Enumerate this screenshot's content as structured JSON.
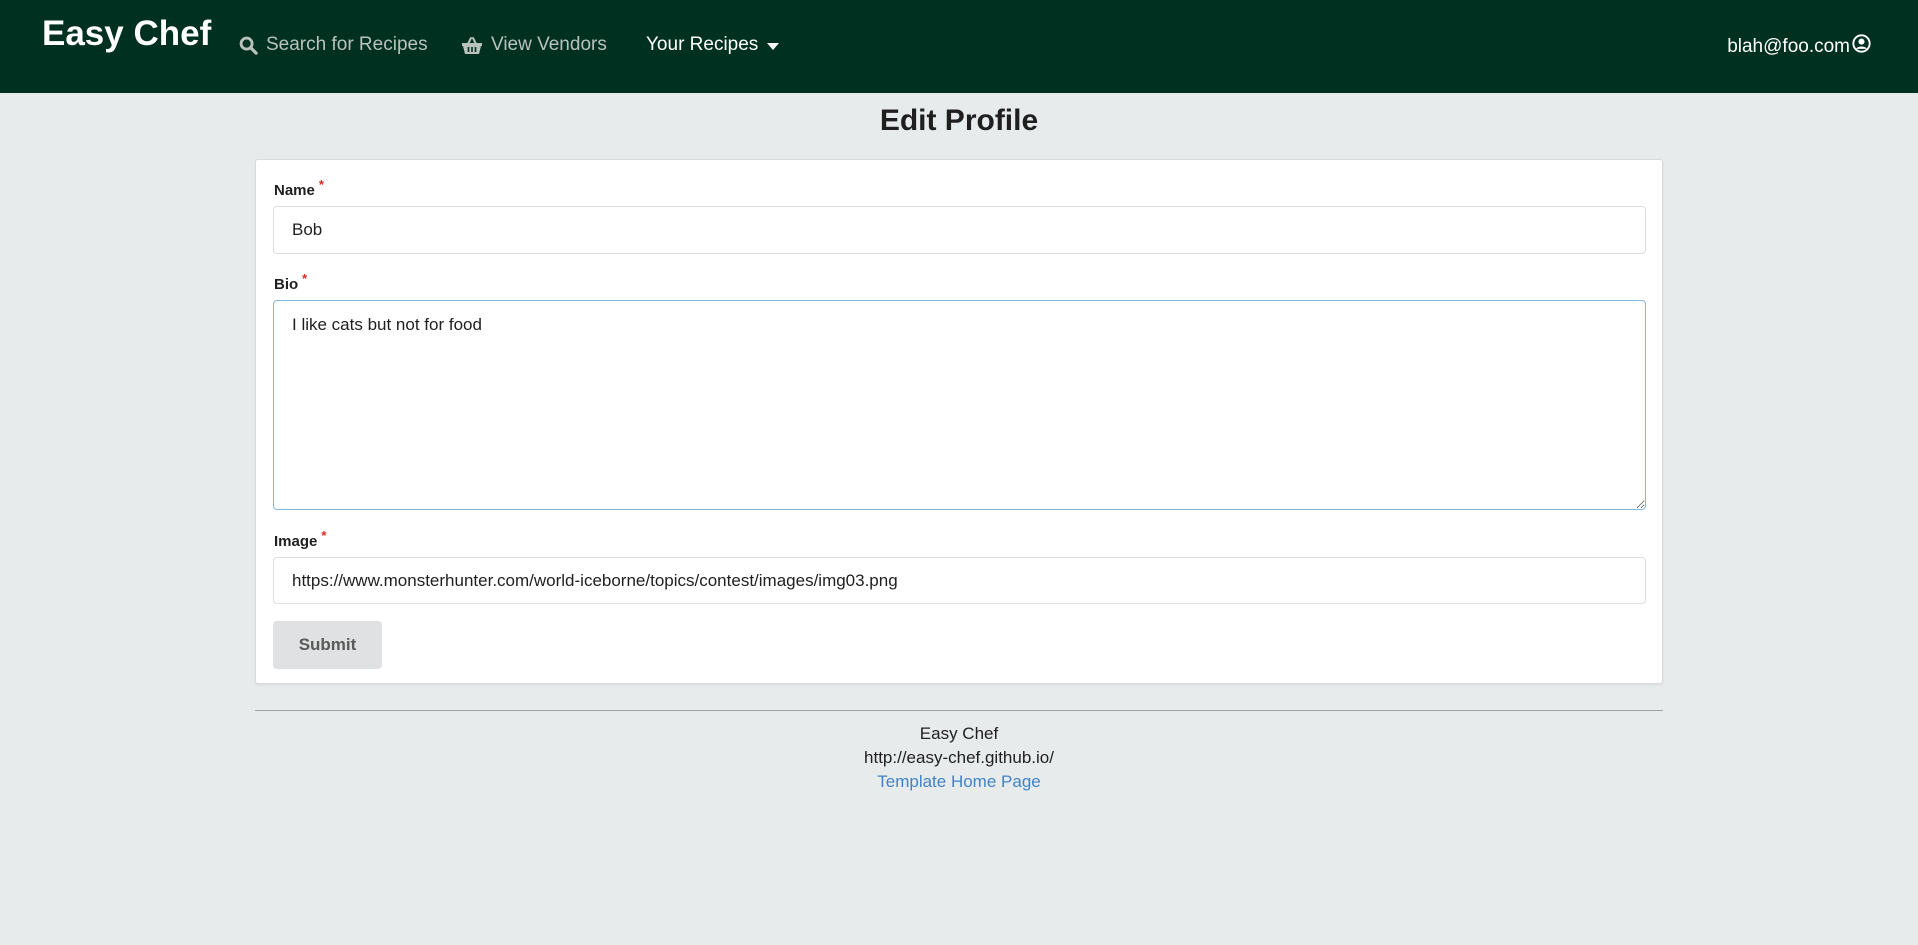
{
  "navbar": {
    "brand": "Easy Chef",
    "search_label": "Search for Recipes",
    "vendors_label": "View Vendors",
    "recipes_label": "Your Recipes",
    "user_email": "blah@foo.com",
    "background_color": "#003020",
    "icons": [
      "search-icon",
      "basket-icon",
      "caret-down-icon",
      "user-circle-icon"
    ]
  },
  "page": {
    "title": "Edit Profile"
  },
  "form": {
    "name_label": "Name",
    "name_required": "*",
    "name_value": "Bob",
    "bio_label": "Bio",
    "bio_required": "*",
    "bio_value": "I like cats but not for food",
    "image_label": "Image",
    "image_required": "*",
    "image_value": "https://www.monsterhunter.com/world-iceborne/topics/contest/images/img03.png",
    "submit_label": "Submit"
  },
  "footer": {
    "line1": "Easy Chef",
    "line2": "http://easy-chef.github.io/",
    "link_label": "Template Home Page",
    "link_color": "#4183c4"
  }
}
